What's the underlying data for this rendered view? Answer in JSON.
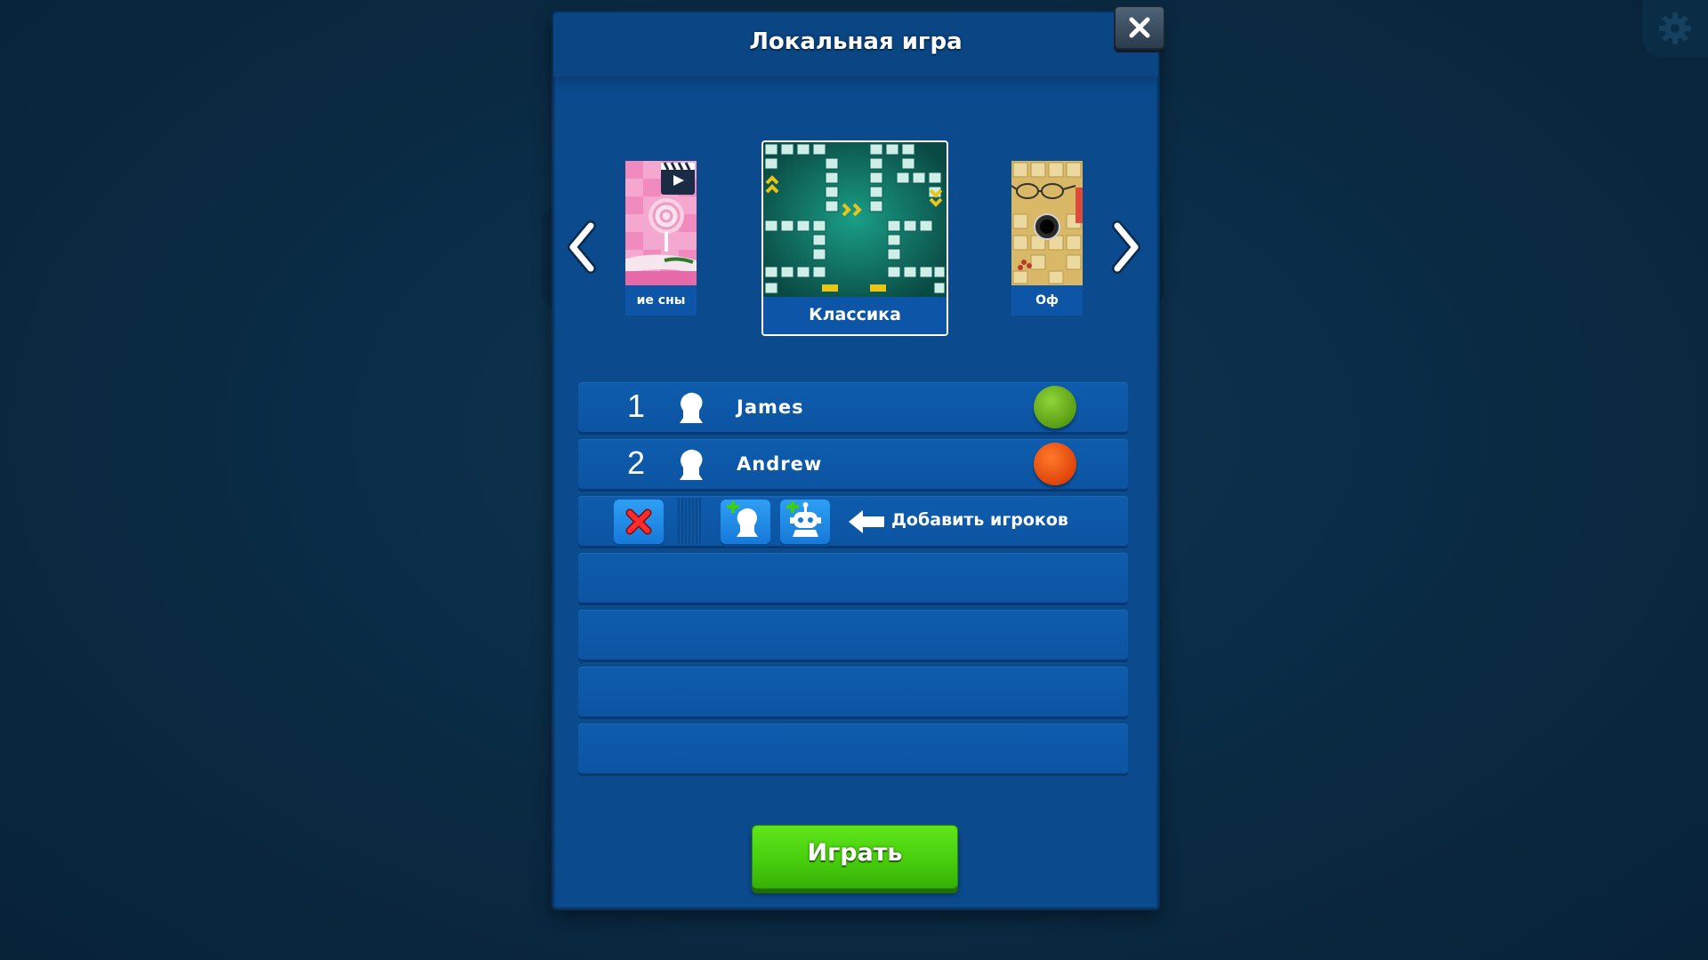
{
  "dialog": {
    "title": "Локальная игра"
  },
  "carousel": {
    "prev_card_label": "ие сны",
    "current_card_label": "Классика",
    "next_card_label": "Оф"
  },
  "players": [
    {
      "number": "1",
      "name": "James",
      "token_color": "#6bb01c"
    },
    {
      "number": "2",
      "name": "Andrew",
      "token_color": "#e04a0c"
    }
  ],
  "add_row": {
    "label": "Добавить игроков"
  },
  "play_button": {
    "label": "Играть"
  },
  "colors": {
    "panel": "#0b4a8c",
    "row": "#0e5cae",
    "accent_green": "#4fd610",
    "background": "#0a2a43"
  }
}
